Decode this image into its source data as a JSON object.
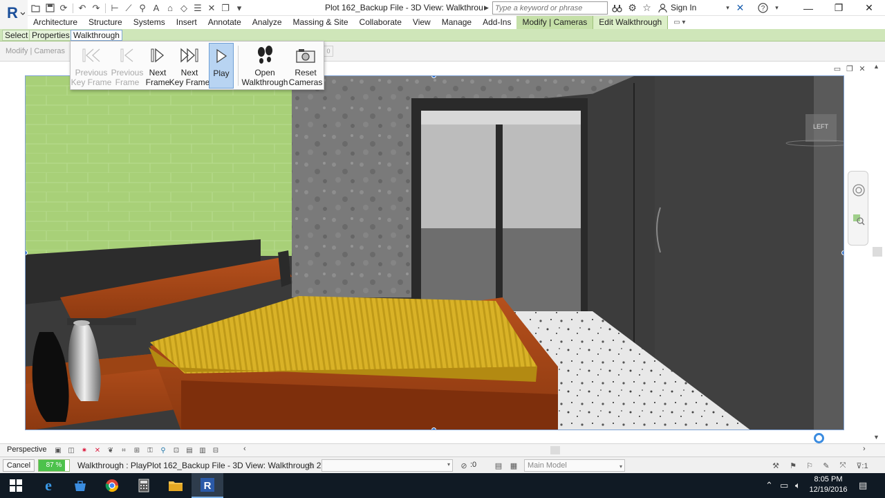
{
  "window": {
    "doc_title": "Plot 162_Backup File - 3D View: Walkthroug...",
    "search_placeholder": "Type a keyword or phrase",
    "sign_in": "Sign In"
  },
  "ribbon": {
    "tabs": [
      "Architecture",
      "Structure",
      "Systems",
      "Insert",
      "Annotate",
      "Analyze",
      "Massing & Site",
      "Collaborate",
      "View",
      "Manage",
      "Add-Ins",
      "Modify | Cameras",
      "Edit Walkthrough"
    ],
    "panel_buttons": [
      "Select",
      "Properties",
      "Walkthrough"
    ],
    "context_label": "Modify | Cameras"
  },
  "walkthrough_panel": {
    "buttons": [
      {
        "label1": "Previous",
        "label2": "Key Frame",
        "icon": "previous-key-frame-icon",
        "enabled": false
      },
      {
        "label1": "Previous",
        "label2": "Frame",
        "icon": "previous-frame-icon",
        "enabled": false
      },
      {
        "label1": "Next",
        "label2": "Frame",
        "icon": "next-frame-icon",
        "enabled": true
      },
      {
        "label1": "Next",
        "label2": "Key Frame",
        "icon": "next-key-frame-icon",
        "enabled": true
      },
      {
        "label1": "Play",
        "label2": "",
        "icon": "play-icon",
        "enabled": true,
        "pressed": true
      },
      {
        "label1": "Open",
        "label2": "Walkthrough",
        "icon": "footsteps-icon",
        "enabled": true
      },
      {
        "label1": "Reset",
        "label2": "Cameras",
        "icon": "camera-icon",
        "enabled": true
      }
    ]
  },
  "view": {
    "viewcube_label": "LEFT",
    "projection": "Perspective"
  },
  "status": {
    "cancel": "Cancel",
    "progress_pct": "87 %",
    "progress_value": 0.87,
    "message": "Walkthrough : PlayPlot 162_Backup File - 3D View: Walkthrough 2",
    "selection_count": ":0",
    "model": "Main Model"
  },
  "taskbar": {
    "time": "8:05 PM",
    "date": "12/19/2016"
  },
  "colors": {
    "context_tab": "#c5e0a8",
    "selection_blue": "#2f6fc9",
    "taskbar": "#101a24"
  }
}
